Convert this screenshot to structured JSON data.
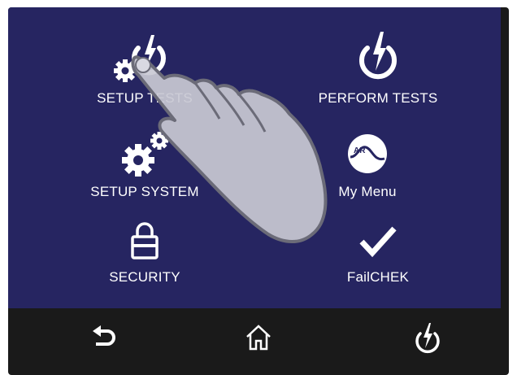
{
  "menu": {
    "setup_tests": "SETUP TESTS",
    "perform_tests": "PERFORM TESTS",
    "setup_system": "SETUP SYSTEM",
    "my_menu": "My Menu",
    "my_menu_badge": "AR",
    "security": "SECURITY",
    "failchek": "FailCHEK"
  },
  "icons": {
    "setup_tests": "gear-power-icon",
    "perform_tests": "power-bolt-icon",
    "setup_system": "gears-icon",
    "my_menu": "ar-logo-icon",
    "security": "lock-icon",
    "failchek": "checkmark-icon",
    "nav_back": "back-arrow-icon",
    "nav_home": "home-icon",
    "nav_power": "power-bolt-icon",
    "overlay": "pointing-hand-icon"
  },
  "colors": {
    "panel": "#262561",
    "navbar": "#1a1a1a",
    "text": "#ffffff",
    "hand_fill": "#c9c9d4",
    "hand_stroke": "#6b6b78"
  }
}
